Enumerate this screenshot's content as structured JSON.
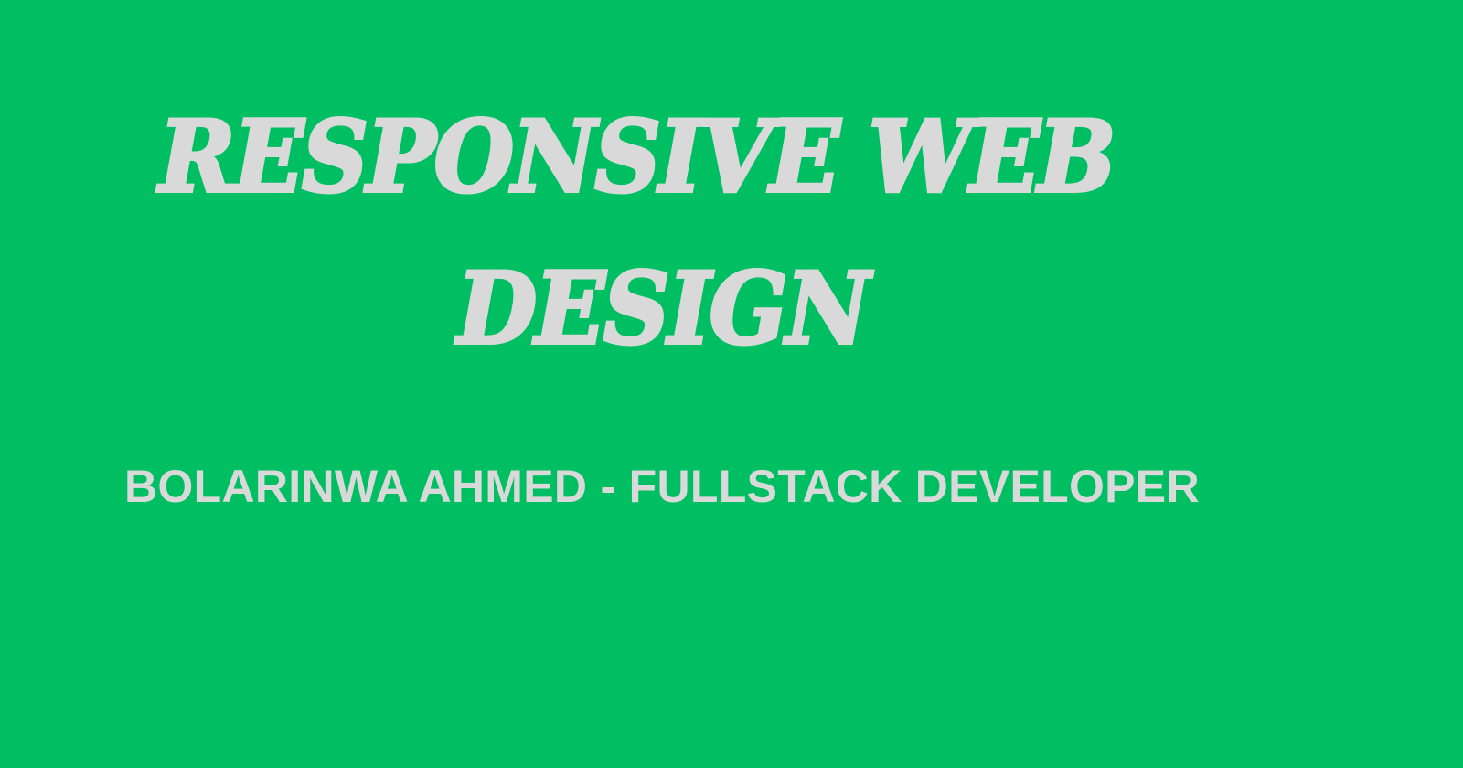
{
  "banner": {
    "background_color": "#00BF63",
    "text_color": "#D9D9D9",
    "title_line_1": "RESPONSIVE WEB",
    "title_line_2": "DESIGN",
    "subtitle": "BOLARINWA AHMED - FULLSTACK DEVELOPER"
  }
}
